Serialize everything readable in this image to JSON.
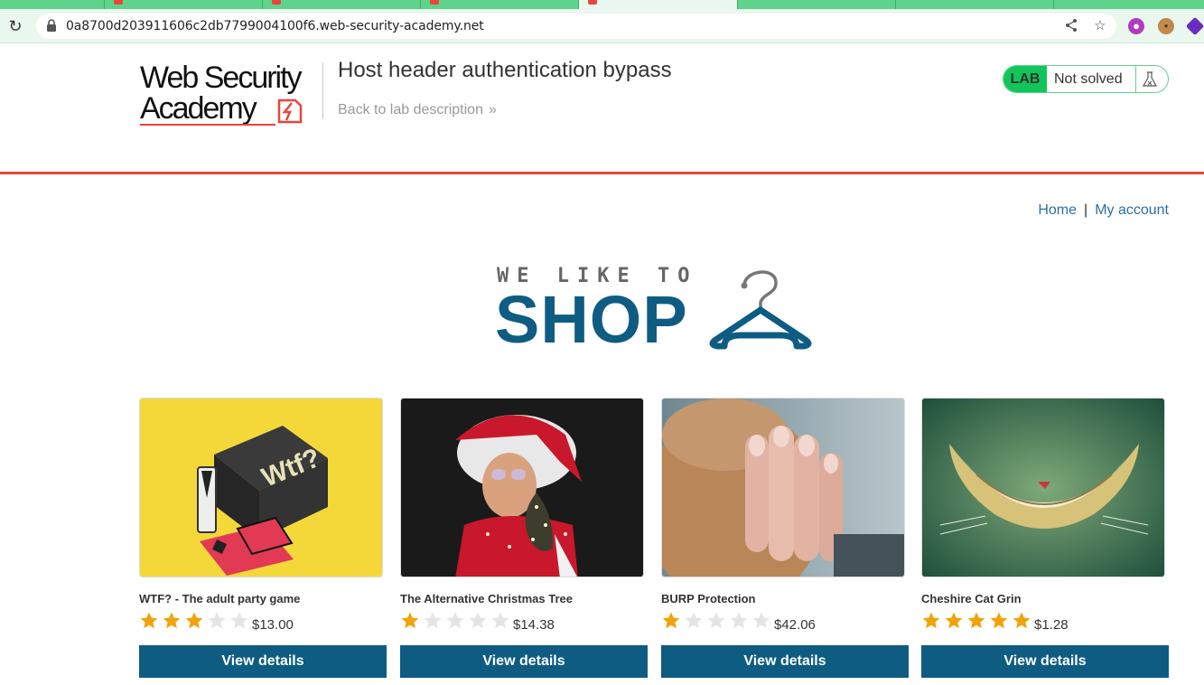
{
  "browser": {
    "url": "0a8700d203911606c2db7799004100f6.web-security-academy.net"
  },
  "header": {
    "logo_line1": "Web Security",
    "logo_line2": "Academy",
    "lab_title": "Host header authentication bypass",
    "back_link": "Back to lab description",
    "lab_badge": "LAB",
    "lab_status": "Not solved"
  },
  "nav": {
    "home": "Home",
    "separator": "|",
    "my_account": "My account"
  },
  "banner": {
    "small": "WE LIKE TO",
    "big": "SHOP"
  },
  "products": [
    {
      "name": "WTF? - The adult party game",
      "rating": 3,
      "price": "$13.00",
      "button": "View details"
    },
    {
      "name": "The Alternative Christmas Tree",
      "rating": 1,
      "price": "$14.38",
      "button": "View details"
    },
    {
      "name": "BURP Protection",
      "rating": 1,
      "price": "$42.06",
      "button": "View details"
    },
    {
      "name": "Cheshire Cat Grin",
      "rating": 5,
      "price": "$1.28",
      "button": "View details"
    }
  ],
  "colors": {
    "accent_blue": "#0e5c82",
    "lab_green": "#12c55b",
    "header_red": "#e8453c",
    "star_filled": "#f0a30a",
    "star_empty": "#e4e4e4"
  }
}
